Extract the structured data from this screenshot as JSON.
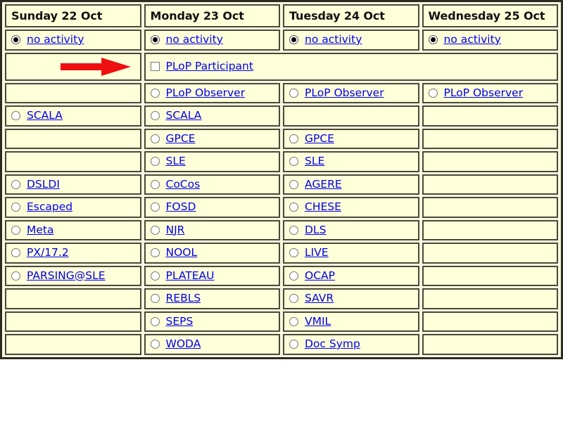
{
  "table": {
    "columns": [
      {
        "label": "Sunday 22 Oct"
      },
      {
        "label": "Monday 23 Oct"
      },
      {
        "label": "Tuesday 24 Oct"
      },
      {
        "label": "Wednesday 25 Oct"
      }
    ],
    "no_activity_row": {
      "sunday": {
        "label": "no activity",
        "control": "radio",
        "checked": true
      },
      "monday": {
        "label": "no activity",
        "control": "radio",
        "checked": true
      },
      "tuesday": {
        "label": "no activity",
        "control": "radio",
        "checked": true
      },
      "wednesday": {
        "label": "no activity",
        "control": "radio",
        "checked": true
      }
    },
    "plop_participant_row": {
      "sunday": {
        "label": "",
        "control": "none",
        "annotation": "red-right-arrow"
      },
      "spanned": {
        "label": "PLoP Participant",
        "control": "checkbox",
        "checked": false,
        "colspan": 3
      }
    },
    "plop_observer_row": {
      "sunday": {
        "label": "",
        "control": "none"
      },
      "monday": {
        "label": "PLoP Observer",
        "control": "radio",
        "checked": false
      },
      "tuesday": {
        "label": "PLoP Observer",
        "control": "radio",
        "checked": false
      },
      "wednesday": {
        "label": "PLoP Observer",
        "control": "radio",
        "checked": false
      }
    },
    "activity_rows": [
      {
        "sunday": "SCALA",
        "monday": "SCALA",
        "tuesday": "",
        "wednesday": ""
      },
      {
        "sunday": "",
        "monday": "GPCE",
        "tuesday": "GPCE",
        "wednesday": ""
      },
      {
        "sunday": "",
        "monday": "SLE",
        "tuesday": "SLE",
        "wednesday": ""
      },
      {
        "sunday": "DSLDI",
        "monday": "CoCos",
        "tuesday": "AGERE",
        "wednesday": ""
      },
      {
        "sunday": "Escaped",
        "monday": "FOSD",
        "tuesday": "CHESE",
        "wednesday": ""
      },
      {
        "sunday": "Meta",
        "monday": "NJR",
        "tuesday": "DLS",
        "wednesday": ""
      },
      {
        "sunday": "PX/17.2",
        "monday": "NOOL",
        "tuesday": "LIVE",
        "wednesday": ""
      },
      {
        "sunday": "PARSING@SLE",
        "monday": "PLATEAU",
        "tuesday": "OCAP",
        "wednesday": ""
      },
      {
        "sunday": "",
        "monday": "REBLS",
        "tuesday": "SAVR",
        "wednesday": ""
      },
      {
        "sunday": "",
        "monday": "SEPS",
        "tuesday": "VMIL",
        "wednesday": ""
      },
      {
        "sunday": "",
        "monday": "WODA",
        "tuesday": "Doc Symp",
        "wednesday": ""
      }
    ]
  },
  "colors": {
    "cell_cream": "#ffffd9",
    "cell_highlight": "#a4b9bf",
    "table_frame": "#fbf8e0",
    "link_blue": "#0000ee",
    "arrow_red": "#ee1111",
    "border_dark": "#4a4a3a"
  },
  "annotation": {
    "arrow_icon": "red-right-arrow",
    "arrow_color": "#ee1111"
  }
}
